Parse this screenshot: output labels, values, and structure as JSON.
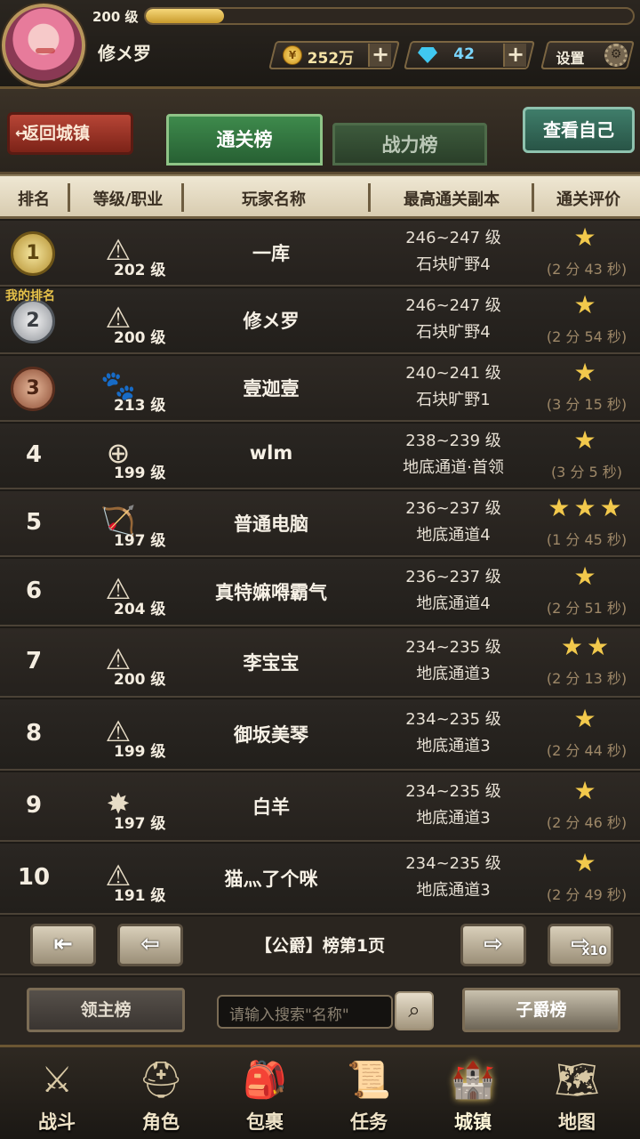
{
  "player": {
    "level": "200 级",
    "xp_fraction": 0.16,
    "name": "修メ罗",
    "gold": "252万",
    "gems": "42",
    "settings": "设置"
  },
  "header": {
    "back": "返回城镇",
    "tab_clear": "通关榜",
    "tab_power": "战力榜",
    "view_self": "查看自己"
  },
  "columns": {
    "rank": "排名",
    "class": "等级/职业",
    "name": "玩家名称",
    "dungeon": "最高通关副本",
    "rating": "通关评价"
  },
  "my_rank_label": "我的排名",
  "rows": [
    {
      "rank": "1",
      "cls_icon": "⚠",
      "level": "202 级",
      "name": "一库",
      "range": "246~247 级",
      "dungeon": "石块旷野4",
      "stars": "★",
      "time": "(2 分 43 秒)"
    },
    {
      "rank": "2",
      "cls_icon": "⚠",
      "level": "200 级",
      "name": "修メ罗",
      "range": "246~247 级",
      "dungeon": "石块旷野4",
      "stars": "★",
      "time": "(2 分 54 秒)"
    },
    {
      "rank": "3",
      "cls_icon": "🐾",
      "level": "213 级",
      "name": "壹迦壹",
      "range": "240~241 级",
      "dungeon": "石块旷野1",
      "stars": "★",
      "time": "(3 分 15 秒)"
    },
    {
      "rank": "4",
      "cls_icon": "⊕",
      "level": "199 级",
      "name": "wlm",
      "range": "238~239 级",
      "dungeon": "地底通道·首领",
      "stars": "★",
      "time": "(3 分 5 秒)"
    },
    {
      "rank": "5",
      "cls_icon": "🏹",
      "level": "197 级",
      "name": "普通电脑",
      "range": "236~237 级",
      "dungeon": "地底通道4",
      "stars": "★★★",
      "time": "(1 分 45 秒)"
    },
    {
      "rank": "6",
      "cls_icon": "⚠",
      "level": "204 级",
      "name": "真特嫲嘚霸气",
      "range": "236~237 级",
      "dungeon": "地底通道4",
      "stars": "★",
      "time": "(2 分 51 秒)"
    },
    {
      "rank": "7",
      "cls_icon": "⚠",
      "level": "200 级",
      "name": "李宝宝",
      "range": "234~235 级",
      "dungeon": "地底通道3",
      "stars": "★★",
      "time": "(2 分 13 秒)"
    },
    {
      "rank": "8",
      "cls_icon": "⚠",
      "level": "199 级",
      "name": "御坂美琴",
      "range": "234~235 级",
      "dungeon": "地底通道3",
      "stars": "★",
      "time": "(2 分 44 秒)"
    },
    {
      "rank": "9",
      "cls_icon": "✸",
      "level": "197 级",
      "name": "白羊",
      "range": "234~235 级",
      "dungeon": "地底通道3",
      "stars": "★",
      "time": "(2 分 46 秒)"
    },
    {
      "rank": "10",
      "cls_icon": "⚠",
      "level": "191 级",
      "name": "猫灬了个咪",
      "range": "234~235 级",
      "dungeon": "地底通道3",
      "stars": "★",
      "time": "(2 分 49 秒)"
    }
  ],
  "pager": {
    "label": "【公爵】榜第1页",
    "first": "⇤",
    "prev": "⇦",
    "next": "⇨",
    "last": "⇨",
    "x10": "x10"
  },
  "search": {
    "left_button": "领主榜",
    "placeholder": "请输入搜索\"名称\"",
    "right_button": "子爵榜"
  },
  "nav": [
    {
      "label": "战斗",
      "icon": "⚔"
    },
    {
      "label": "角色",
      "icon": "⛑"
    },
    {
      "label": "包裹",
      "icon": "🎒"
    },
    {
      "label": "任务",
      "icon": "📜"
    },
    {
      "label": "城镇",
      "icon": "🏰"
    },
    {
      "label": "地图",
      "icon": "🗺"
    }
  ]
}
